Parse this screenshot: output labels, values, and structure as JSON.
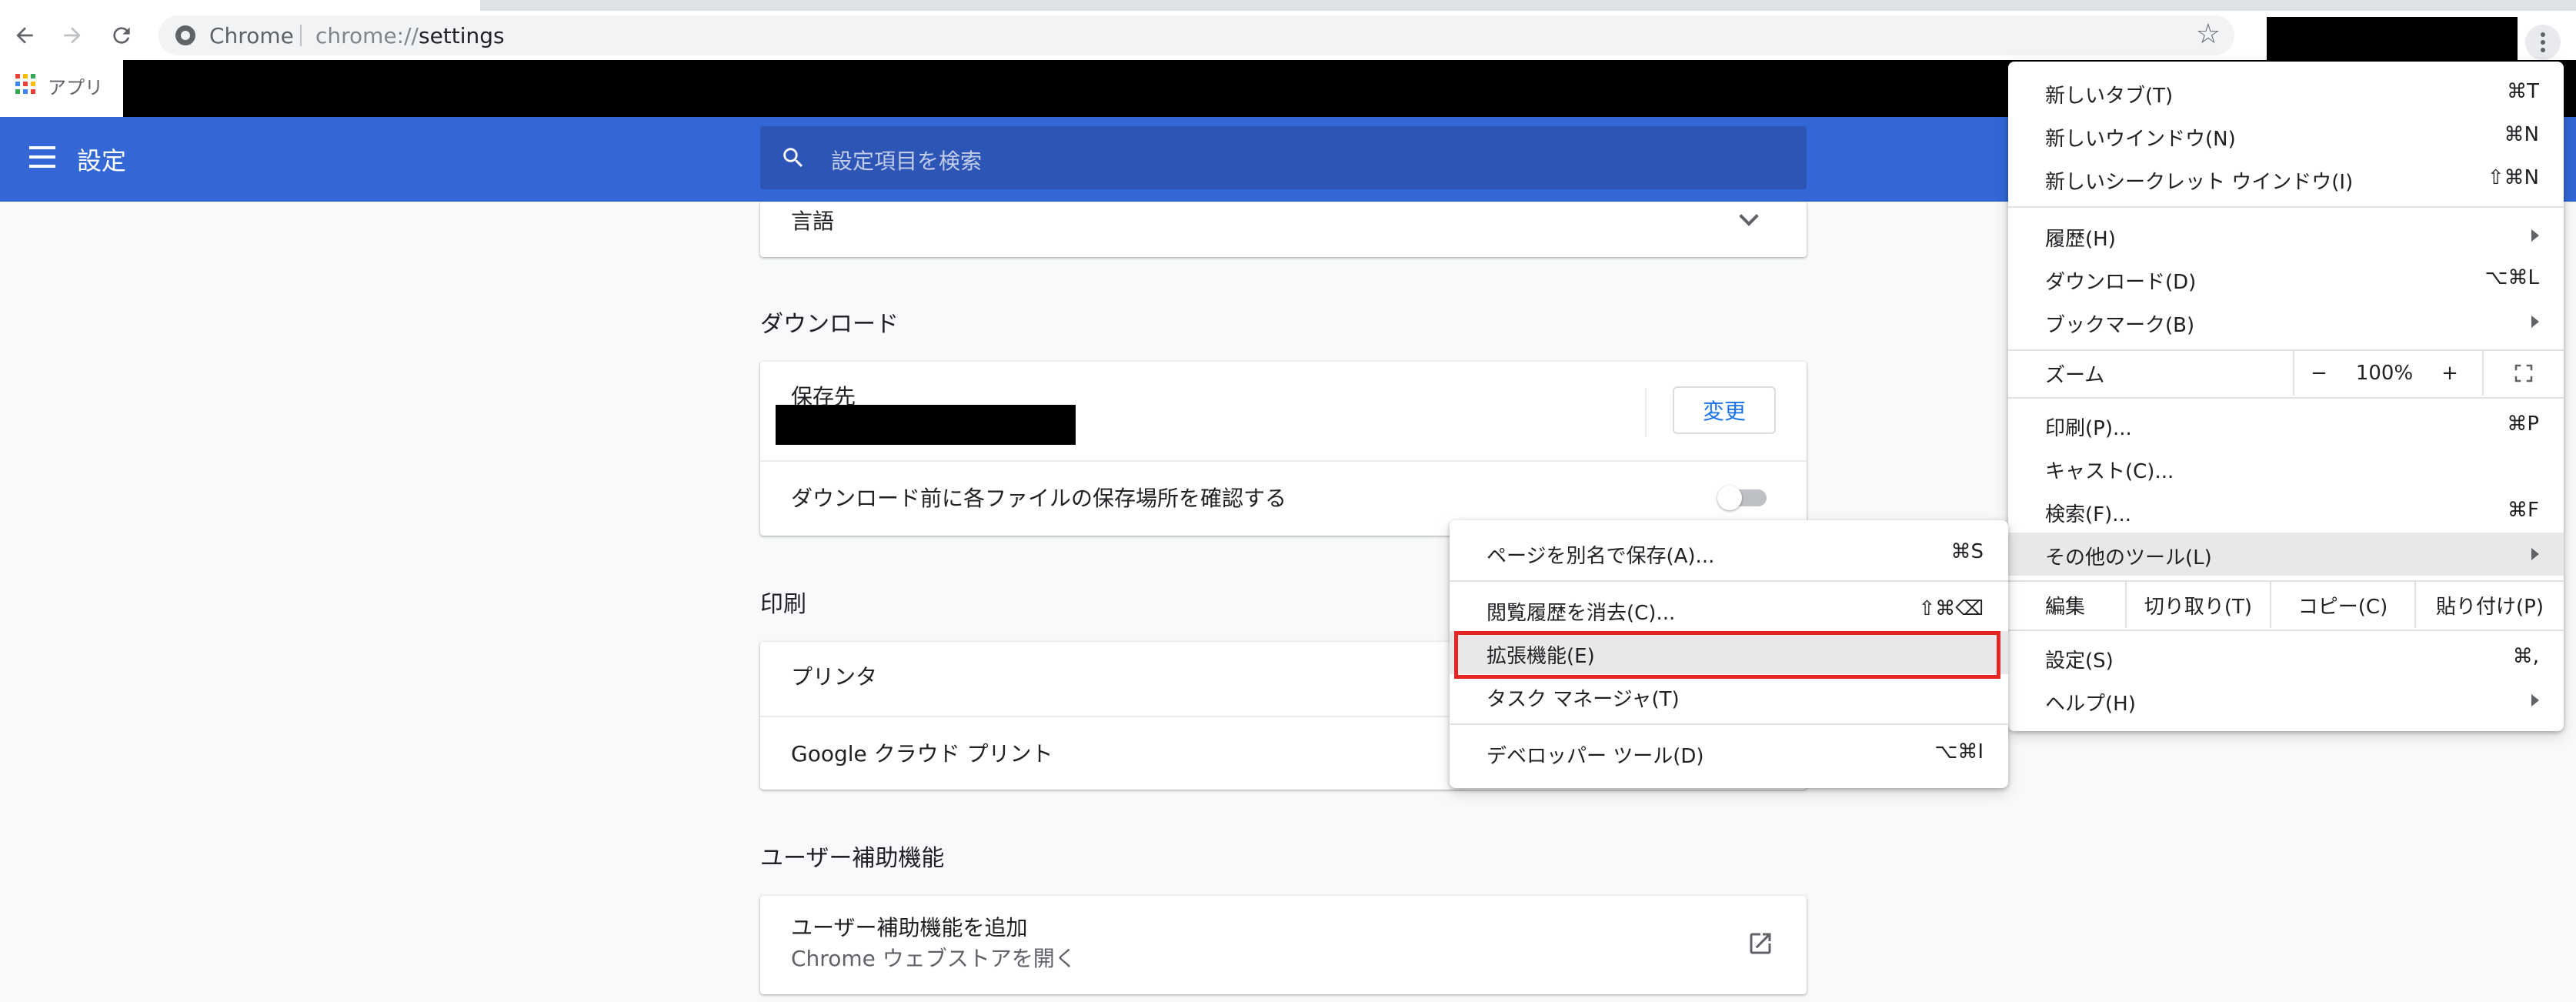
{
  "browser": {
    "omnibox_site": "Chrome",
    "url_scheme": "chrome://",
    "url_host": "settings",
    "apps_label": "アプリ"
  },
  "settings": {
    "title": "設定",
    "search_placeholder": "設定項目を検索",
    "language_label": "言語",
    "downloads": {
      "section_title": "ダウンロード",
      "location_label": "保存先",
      "change_button": "変更",
      "ask_location_label": "ダウンロード前に各ファイルの保存場所を確認する",
      "ask_location_enabled": false
    },
    "printing": {
      "section_title": "印刷",
      "printers_label": "プリンタ",
      "cloud_print_label": "Google クラウド プリント"
    },
    "accessibility": {
      "section_title": "ユーザー補助機能",
      "add_label": "ユーザー補助機能を追加",
      "add_sublabel": "Chrome ウェブストアを開く"
    }
  },
  "chrome_menu": {
    "new_tab": {
      "label": "新しいタブ(T)",
      "shortcut": "⌘T"
    },
    "new_window": {
      "label": "新しいウインドウ(N)",
      "shortcut": "⌘N"
    },
    "new_incognito": {
      "label": "新しいシークレット ウインドウ(I)",
      "shortcut": "⇧⌘N"
    },
    "history": {
      "label": "履歴(H)"
    },
    "downloads": {
      "label": "ダウンロード(D)",
      "shortcut": "⌥⌘L"
    },
    "bookmarks": {
      "label": "ブックマーク(B)"
    },
    "zoom": {
      "label": "ズーム",
      "minus": "−",
      "value": "100%",
      "plus": "+"
    },
    "print": {
      "label": "印刷(P)...",
      "shortcut": "⌘P"
    },
    "cast": {
      "label": "キャスト(C)..."
    },
    "find": {
      "label": "検索(F)...",
      "shortcut": "⌘F"
    },
    "more_tools": {
      "label": "その他のツール(L)"
    },
    "edit": {
      "label": "編集",
      "cut": "切り取り(T)",
      "copy": "コピー(C)",
      "paste": "貼り付け(P)"
    },
    "settings": {
      "label": "設定(S)",
      "shortcut": "⌘,"
    },
    "help": {
      "label": "ヘルプ(H)"
    }
  },
  "more_tools_menu": {
    "save_page": {
      "label": "ページを別名で保存(A)...",
      "shortcut": "⌘S"
    },
    "clear_data": {
      "label": "閲覧履歴を消去(C)...",
      "shortcut": "⇧⌘⌫"
    },
    "extensions": {
      "label": "拡張機能(E)"
    },
    "task_manager": {
      "label": "タスク マネージャ(T)"
    },
    "developer_tools": {
      "label": "デベロッパー ツール(D)",
      "shortcut": "⌥⌘I"
    }
  },
  "colors": {
    "header_blue": "#3367d6",
    "search_blue": "#2c55b5",
    "highlight_red": "#e52424",
    "link_blue": "#1a73e8"
  }
}
